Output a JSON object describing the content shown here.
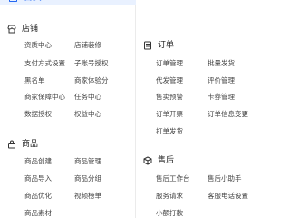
{
  "nav": {
    "home": {
      "label": "首页",
      "icon": "home-icon",
      "active": true,
      "accent": "#2468f2"
    }
  },
  "sections": {
    "store": {
      "title": "店铺",
      "icon": "store-icon",
      "items": [
        "资质中心",
        "店铺装修",
        "支付方式设置",
        "子账号授权",
        "黑名单",
        "商家体验分",
        "商家保障中心",
        "任务中心",
        "数据授权",
        "权益中心"
      ]
    },
    "goods": {
      "title": "商品",
      "icon": "goods-bag-icon",
      "items": [
        "商品创建",
        "商品管理",
        "商品导入",
        "商品分组",
        "商品优化",
        "视频榜单",
        "商品素材"
      ]
    },
    "orders": {
      "title": "订单",
      "icon": "order-list-icon",
      "items": [
        "订单管理",
        "批量发货",
        "代发管理",
        "评价管理",
        "售卖预警",
        "卡券管理",
        "订单开票",
        "订单信息变更",
        "打单发货"
      ]
    },
    "after_sales": {
      "title": "售后",
      "icon": "after-sales-cube-icon",
      "items": [
        "售后工作台",
        "售后小助手",
        "服务请求",
        "客服电话设置",
        "小额打款"
      ]
    }
  }
}
